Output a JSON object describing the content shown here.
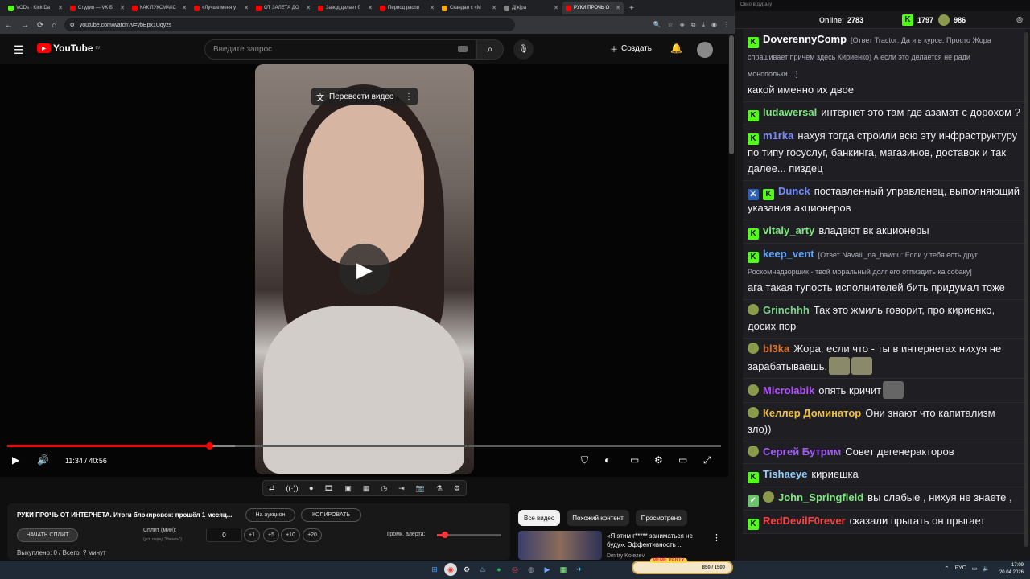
{
  "browser": {
    "tabs": [
      {
        "label": "VODs - Kick Da",
        "color": "#53fc18"
      },
      {
        "label": "Студия — VK Б",
        "color": "#ff0000"
      },
      {
        "label": "КАК ЛУКСМАКС",
        "color": "#ff0000"
      },
      {
        "label": "«Лучше меня у",
        "color": "#ff0000"
      },
      {
        "label": "ОТ ЗАЛЕТА ДО",
        "color": "#ff0000"
      },
      {
        "label": "Завод делает б",
        "color": "#ff0000"
      },
      {
        "label": "Период распи",
        "color": "#ff0000"
      },
      {
        "label": "Скандал с «М",
        "color": "#f9ab00"
      },
      {
        "label": "Д[ж]ра",
        "color": "#888888"
      },
      {
        "label": "РУКИ ПРОЧЬ О",
        "color": "#ff0000"
      }
    ],
    "url": "youtube.com/watch?v=ybEpx1Uqyzs"
  },
  "youtube": {
    "logo": "YouTube",
    "region": "LV",
    "search_placeholder": "Введите запрос",
    "create_label": "Создать"
  },
  "player": {
    "translate_label": "Перевести видео",
    "time": "11:34 / 40:56",
    "progress": 0.283
  },
  "panel": {
    "video_title": "РУКИ ПРОЧЬ ОТ ИНТЕРНЕТА. Итоги блокировок: прошёл 1 месяц...",
    "auction_label": "На аукцион",
    "copy_label": "КОПИРОВАТЬ",
    "split_button": "НАЧАТЬ СПЛИТ",
    "split_label": "Сплит (мин):",
    "split_hint": "(уст. перед \"Начать\")",
    "split_value": "0",
    "steps": [
      "+1",
      "+5",
      "+10",
      "+20"
    ],
    "alert_volume_label": "Громк. алерта:",
    "alert_volume": 0.12,
    "bought": "Выкуплено: 0 / Всего: ? минут"
  },
  "recommendations": {
    "tabs": [
      "Все видео",
      "Похожий контент",
      "Просмотрено"
    ],
    "first_title": "«Я этим г***** заниматься не буду». Эффективность ...",
    "first_channel": "Dmitry Kolezev"
  },
  "chat": {
    "window_title": "Окно в дураку",
    "online_label": "Online:",
    "online": "2783",
    "kick_count": "1797",
    "frog_count": "986",
    "messages": [
      {
        "badge": "kick",
        "user": "DoverennyComp",
        "color": "#ffffff",
        "reply": "[Ответ Tractor: Да я в курсе. Просто Жора спрашивает причем здесь Кириенко) А если это делается не ради монопольки....]",
        "text": "какой именно их двое"
      },
      {
        "badge": "kick",
        "user": "ludawersal",
        "color": "#7fe87f",
        "reply": "",
        "text": "интернет это там где азамат с дорохом ?"
      },
      {
        "badge": "kick",
        "user": "m1rka",
        "color": "#7c8cff",
        "reply": "",
        "text": "нахуя тогда строили всю эту инфраструктуру по типу госуслуг, банкинга, магазинов, доставок и так далее... пиздец"
      },
      {
        "badge": "sword",
        "user": "Dunck",
        "color": "#6f8bff",
        "reply": "",
        "text": "поставленный управленец, выполняющий указания акционеров"
      },
      {
        "badge": "kick",
        "user": "vitaly_arty",
        "color": "#7fe87f",
        "reply": "",
        "text": "владеют вк акционеры"
      },
      {
        "badge": "kick",
        "user": "keep_vent",
        "color": "#5aa5ff",
        "reply": "[Ответ Navalil_na_bawnu: Если у тебя есть друг Роскомнадзорщик - твой моральный долг его отпиздить ка собаку]",
        "text": "ага такая тупость исполнителей бить придумал тоже"
      },
      {
        "badge": "frog",
        "user": "Grinchhh",
        "color": "#7ad08a",
        "reply": "",
        "text": "Так это жмиль говорит, про кириенко, досих пор"
      },
      {
        "badge": "frog",
        "user": "bl3ka",
        "color": "#e0732c",
        "reply": "",
        "text": "Жора, если что - ты в интернетах нихуя не зарабатываешь."
      },
      {
        "badge": "frog",
        "user": "Microlabik",
        "color": "#b450ff",
        "reply": "",
        "text": "опять кричит"
      },
      {
        "badge": "frog",
        "user": "Келлер Доминатор",
        "color": "#f0c040",
        "reply": "",
        "text": "Они знают что капитализм зло))"
      },
      {
        "badge": "frog",
        "user": "Сергей Бутрим",
        "color": "#a45cff",
        "reply": "",
        "text": "Совет дегенеракторов"
      },
      {
        "badge": "kick",
        "user": "Tishaeye",
        "color": "#8fd0ff",
        "reply": "",
        "text": "кириешка"
      },
      {
        "badge": "checkfrog",
        "user": "John_Springfield",
        "color": "#7fe87f",
        "reply": "",
        "text": "вы слабые , нихуя не знаете ,"
      },
      {
        "badge": "kick",
        "user": "RedDevilF0rever",
        "color": "#ff4040",
        "reply": "",
        "text": "сказали прыгать он прыгает"
      }
    ]
  },
  "taskbar": {
    "meme_label": "MEME PARTY",
    "meme_progress": "850 / 1500",
    "lang": "РУС",
    "time": "17:09",
    "date": "20.04.2026"
  }
}
